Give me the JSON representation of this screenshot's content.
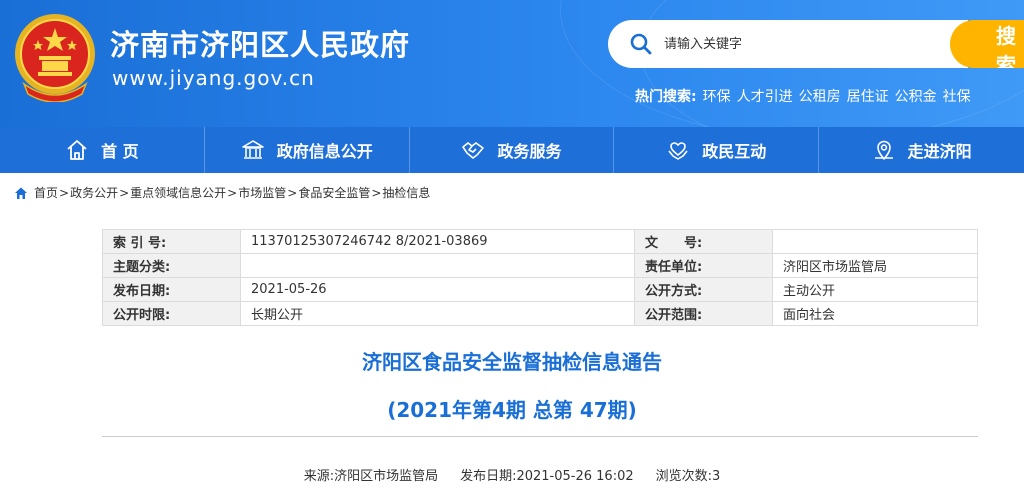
{
  "header": {
    "site_title": "济南市济阳区人民政府",
    "site_url": "www.jiyang.gov.cn",
    "search": {
      "placeholder": "请输入关键字",
      "button_label": "搜索"
    },
    "hot_search": {
      "label": "热门搜索:",
      "items": [
        "环保",
        "人才引进",
        "公租房",
        "居住证",
        "公积金",
        "社保"
      ]
    }
  },
  "nav": {
    "items": [
      {
        "label": "首 页",
        "icon": "home-icon"
      },
      {
        "label": "政府信息公开",
        "icon": "government-building-icon"
      },
      {
        "label": "政务服务",
        "icon": "handshake-icon"
      },
      {
        "label": "政民互动",
        "icon": "heart-hands-icon"
      },
      {
        "label": "走进济阳",
        "icon": "location-pin-icon"
      }
    ]
  },
  "breadcrumb": [
    "首页",
    "政务公开",
    "重点领域信息公开",
    "市场监管",
    "食品安全监管",
    "抽检信息"
  ],
  "meta": {
    "rows": [
      {
        "label1": "索 引 号:",
        "value1": "11370125307246742 8/2021-03869",
        "label2": "文　　号:",
        "value2": ""
      },
      {
        "label1": "主题分类:",
        "value1": "",
        "label2": "责任单位:",
        "value2": "济阳区市场监管局"
      },
      {
        "label1": "发布日期:",
        "value1": "2021-05-26",
        "label2": "公开方式:",
        "value2": "主动公开"
      },
      {
        "label1": "公开时限:",
        "value1": "长期公开",
        "label2": "公开范围:",
        "value2": "面向社会"
      }
    ]
  },
  "article": {
    "title": "济阳区食品安全监督抽检信息通告",
    "subtitle": "(2021年第4期 总第 47期)",
    "source": "来源:济阳区市场监管局",
    "publish_date": "发布日期:2021-05-26 16:02",
    "views": "浏览次数:3"
  },
  "colors": {
    "header_blue": "#2b86ee",
    "nav_blue": "#1f6fd8",
    "search_button": "#ffb400",
    "title_blue": "#1a6fd6"
  }
}
